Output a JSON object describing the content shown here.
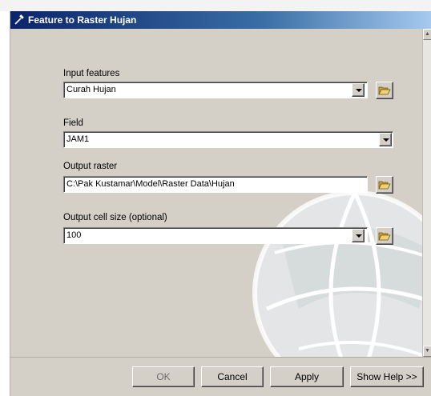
{
  "window": {
    "title": "Feature to Raster Hujan"
  },
  "form": {
    "input_features": {
      "label": "Input features",
      "value": "Curah Hujan"
    },
    "field": {
      "label": "Field",
      "value": "JAM1"
    },
    "output_raster": {
      "label": "Output raster",
      "value": "C:\\Pak Kustamar\\Model\\Raster Data\\Hujan"
    },
    "cell_size": {
      "label": "Output cell size (optional)",
      "value": "100"
    }
  },
  "buttons": {
    "ok": "OK",
    "cancel": "Cancel",
    "apply": "Apply",
    "help": "Show Help >>"
  },
  "colors": {
    "title_bar": "#0a246a",
    "dialog_bg": "#d4d0c8",
    "field_bg": "#ffffff"
  },
  "icons": {
    "tool": "hammer-icon",
    "browse": "open-folder-icon",
    "dropdown": "chevron-down-icon",
    "watermark": "globe-icon"
  }
}
